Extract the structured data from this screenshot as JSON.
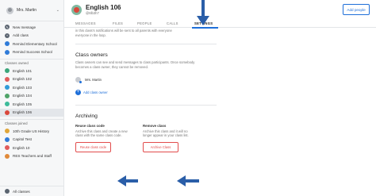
{
  "sidebar": {
    "user_name": "Mrs. Martin",
    "top_items": [
      {
        "label": "New message",
        "icon": "pencil-icon",
        "color": "#5b6470"
      },
      {
        "label": "Add class",
        "icon": "plus-icon",
        "color": "#5b6470"
      },
      {
        "label": "Remind Elementary School",
        "icon": "school-icon",
        "color": "#2f7bd8"
      },
      {
        "label": "Remind Success School",
        "icon": "school-icon",
        "color": "#2f7bd8"
      }
    ],
    "owned_header": "Classes owned",
    "owned": [
      {
        "label": "English 101",
        "color": "#3aa57a"
      },
      {
        "label": "English 102",
        "color": "#e05b5b"
      },
      {
        "label": "English 103",
        "color": "#2f9bd8"
      },
      {
        "label": "English 104",
        "color": "#4fa368"
      },
      {
        "label": "English 105",
        "color": "#3dbb9a"
      },
      {
        "label": "English 106",
        "color": "#d9473b"
      }
    ],
    "joined_header": "Classes joined",
    "joined": [
      {
        "label": "10th Grade US History",
        "color": "#e0a63a"
      },
      {
        "label": "Capitol Test",
        "color": "#2f7bd8"
      },
      {
        "label": "English 10",
        "color": "#e05b5b"
      },
      {
        "label": "RES Teachers and Staff",
        "color": "#e08a3a"
      }
    ],
    "footer": "All classes"
  },
  "header": {
    "class_name": "English 106",
    "class_code": "@6lb3h7",
    "add_people": "Add people"
  },
  "tabs": [
    "MESSAGES",
    "FILES",
    "PEOPLE",
    "CALLS",
    "SETTINGS"
  ],
  "intro_text": [
    "in this class's notifications will be sent to all parents with everyone",
    "everyone in the loop."
  ],
  "owners": {
    "title": "Class owners",
    "description": [
      "Class owners can see and send messages to class participants. Once somebody",
      "becomes a class owner, they cannot be removed."
    ],
    "owner_name": "Mrs. Martin",
    "add_owner": "Add class owner"
  },
  "archiving": {
    "title": "Archiving",
    "reuse": {
      "title": "Reuse class code",
      "description": [
        "Archive this class and create a new",
        "class with the same class code."
      ],
      "button": "Reuse class code"
    },
    "remove": {
      "title": "Remove class",
      "description": [
        "Archive this class and it will no",
        "longer appear in your class list."
      ],
      "button": "Archive Class"
    }
  },
  "colors": {
    "accent": "#1e6fd9",
    "danger": "#e24c4c",
    "arrow": "#2a5ea8"
  }
}
